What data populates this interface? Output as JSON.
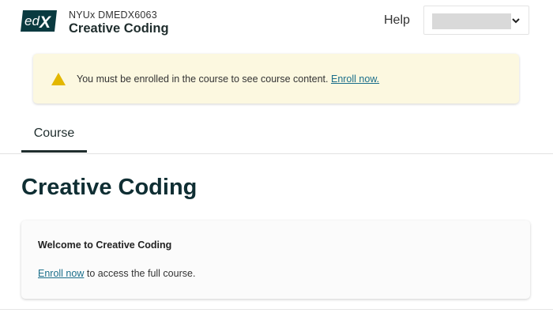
{
  "header": {
    "logo_text": "edX",
    "course_org": "NYUx DMEDX6063",
    "course_title": "Creative Coding",
    "help_label": "Help",
    "user_menu": {
      "username": "",
      "icon": "chevron-down-icon"
    }
  },
  "alert": {
    "icon": "warning-icon",
    "message": "You must be enrolled in the course to see course content.",
    "link_label": "Enroll now."
  },
  "tabs": [
    {
      "label": "Course",
      "active": true
    }
  ],
  "main": {
    "title": "Creative Coding",
    "card": {
      "heading": "Welcome to Creative Coding",
      "link_label": "Enroll now",
      "suffix_text": "to access the full course."
    }
  },
  "colors": {
    "brand_dark": "#0f2e33",
    "link": "#1a6e8a",
    "alert_bg": "#fcf8e0",
    "warning_yellow": "#e3b700"
  }
}
